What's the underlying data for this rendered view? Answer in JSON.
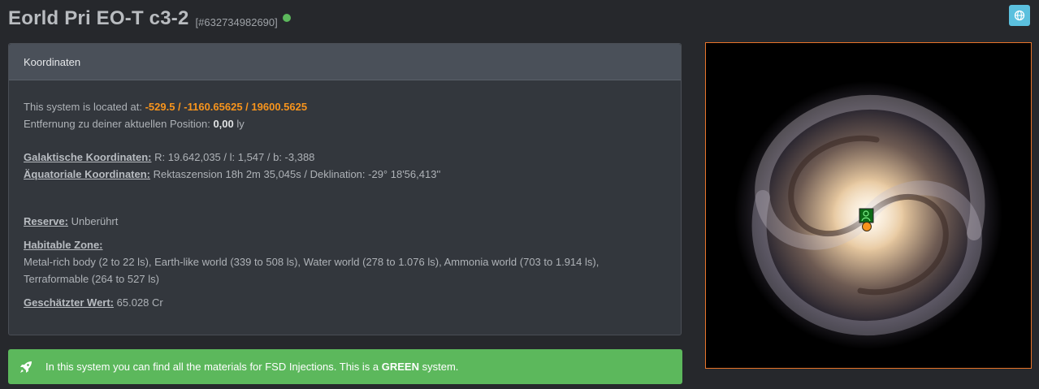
{
  "header": {
    "title": "Eorld Pri EO-T c3-2",
    "system_id": "[#632734982690]",
    "status_color": "#5cb85c",
    "globe_icon": "globe-icon"
  },
  "panel": {
    "heading": "Koordinaten",
    "located_prefix": "This system is located at:",
    "coordinates": "-529.5 / -1160.65625 / 19600.5625",
    "distance_prefix": "Entfernung zu deiner aktuellen Position:",
    "distance_value": "0,00",
    "distance_unit": "ly",
    "galactic_label": "Galaktische Koordinaten:",
    "galactic_value": "R: 19.642,035 / l: 1,547 / b: -3,388",
    "equatorial_label": "Äquatoriale Koordinaten:",
    "equatorial_value": "Rektaszension 18h 2m 35,045s / Deklination: -29° 18'56,413''",
    "reserve_label": "Reserve:",
    "reserve_value": "Unberührt",
    "habitable_label": "Habitable Zone:",
    "habitable_line1": "Metal-rich body (2 to 22 ls), Earth-like world (339 to 508 ls), Water world (278 to 1.076 ls), Ammonia world (703 to 1.914 ls),",
    "habitable_line2": "Terraformable (264 to 527 ls)",
    "value_label": "Geschätzter Wert:",
    "value_value": "65.028 Cr"
  },
  "alert": {
    "icon": "rocket-icon",
    "text_before": "In this system you can find all the materials for FSD Injections. This is a ",
    "text_bold": "GREEN",
    "text_after": " system.",
    "color": "#5cb85c"
  },
  "map": {
    "image": "galaxy-map",
    "marker_icon": "commander-marker-icon",
    "accent": "#e8742a"
  }
}
